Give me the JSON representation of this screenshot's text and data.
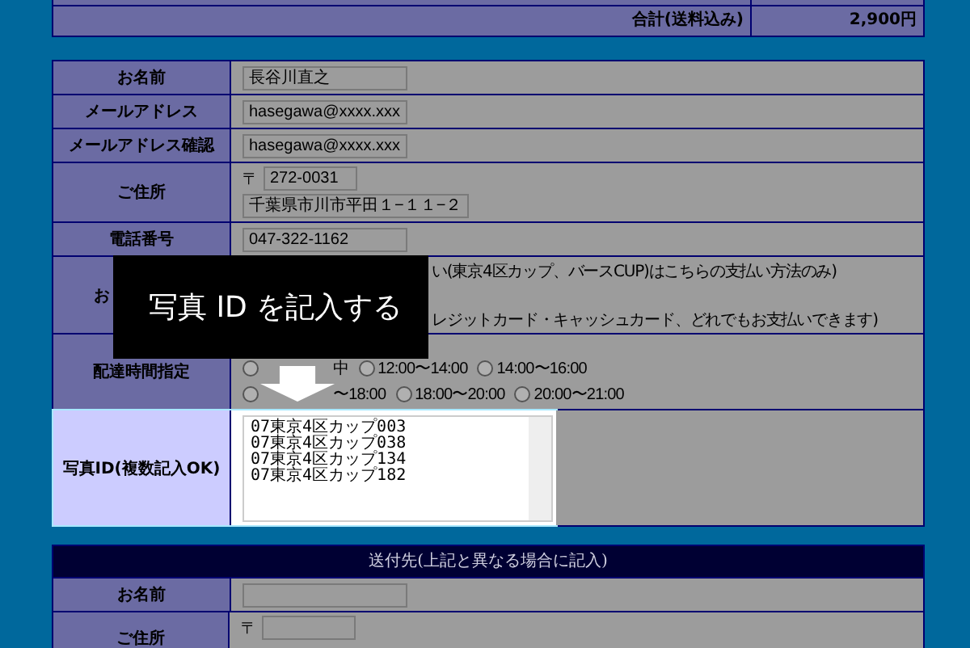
{
  "summary": {
    "label": "合計(送料込み)",
    "value": "2,900円"
  },
  "customer_form": {
    "rows": [
      {
        "kind": "field",
        "label": "お名前",
        "value": "長谷川直之"
      },
      {
        "kind": "field",
        "label": "メールアドレス",
        "value": "hasegawa@xxxx.xxx"
      },
      {
        "kind": "field",
        "label": "メールアドレス確認",
        "value": "hasegawa@xxxx.xxx"
      },
      {
        "kind": "address",
        "label": "ご住所",
        "zip_mark": "〒",
        "zip": "272-0031",
        "address": "千葉県市川市平田１−１１−２"
      },
      {
        "kind": "field",
        "label": "電話番号",
        "value": "047-322-1162"
      },
      {
        "kind": "payment",
        "label": "お",
        "lines": [
          "い(東京4区カップ、バースCUP)はこちらの支払い方法のみ)",
          "レジットカード・キャッシュカード、どれでもお支払いできます)"
        ]
      },
      {
        "kind": "radios",
        "label": "配達時間指定",
        "lines": [
          [
            {
              "label": "中",
              "selected": false
            },
            {
              "label": "12:00〜14:00",
              "selected": false
            },
            {
              "label": "14:00〜16:00",
              "selected": false
            }
          ],
          [
            {
              "label": "〜18:00",
              "selected": false
            },
            {
              "label": "18:00〜20:00",
              "selected": false
            },
            {
              "label": "20:00〜21:00",
              "selected": false
            }
          ]
        ]
      },
      {
        "kind": "textarea",
        "label": "写真ID(複数記入OK)",
        "highlighted": true,
        "value": "07東京4区カップ003\n07東京4区カップ038\n07東京4区カップ134\n07東京4区カップ182"
      }
    ]
  },
  "shipping_form": {
    "title": "送付先(上記と異なる場合に記入)",
    "rows": [
      {
        "kind": "field",
        "label": "お名前"
      },
      {
        "kind": "address",
        "label": "ご住所",
        "zip_mark": "〒"
      }
    ]
  },
  "callout": {
    "text": "写真 ID を記入する"
  }
}
